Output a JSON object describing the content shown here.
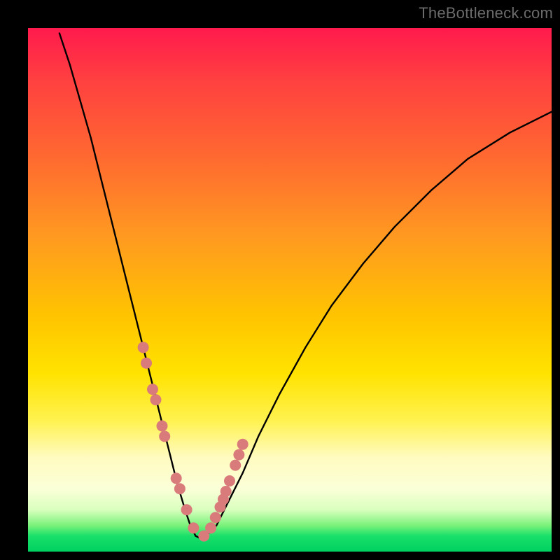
{
  "watermark": "TheBottleneck.com",
  "chart_data": {
    "type": "line",
    "title": "",
    "xlabel": "",
    "ylabel": "",
    "xlim": [
      0,
      100
    ],
    "ylim": [
      0,
      100
    ],
    "series": [
      {
        "name": "bottleneck-curve",
        "x": [
          6,
          8,
          10,
          12,
          14,
          16,
          18,
          20,
          22,
          24,
          25.5,
          27,
          28.5,
          30,
          31,
          32,
          33,
          34,
          36,
          38,
          41,
          44,
          48,
          53,
          58,
          64,
          70,
          77,
          84,
          92,
          100
        ],
        "y": [
          99,
          93,
          86,
          79,
          71,
          63,
          55,
          47,
          39,
          31,
          25,
          19,
          13,
          8,
          5,
          3,
          2.5,
          3,
          5,
          9,
          15,
          22,
          30,
          39,
          47,
          55,
          62,
          69,
          75,
          80,
          84
        ]
      }
    ],
    "markers": {
      "name": "highlight-points",
      "color": "#d97b7b",
      "x": [
        22.0,
        22.6,
        23.8,
        24.4,
        25.6,
        26.1,
        28.3,
        29.0,
        30.3,
        31.6,
        33.6,
        34.9,
        35.8,
        36.7,
        37.3,
        37.8,
        38.5,
        39.6,
        40.3,
        41.0
      ],
      "y": [
        39,
        36,
        31,
        29,
        24,
        22,
        14,
        12,
        8,
        4.5,
        3,
        4.5,
        6.5,
        8.5,
        10,
        11.5,
        13.5,
        16.5,
        18.5,
        20.5
      ]
    }
  }
}
